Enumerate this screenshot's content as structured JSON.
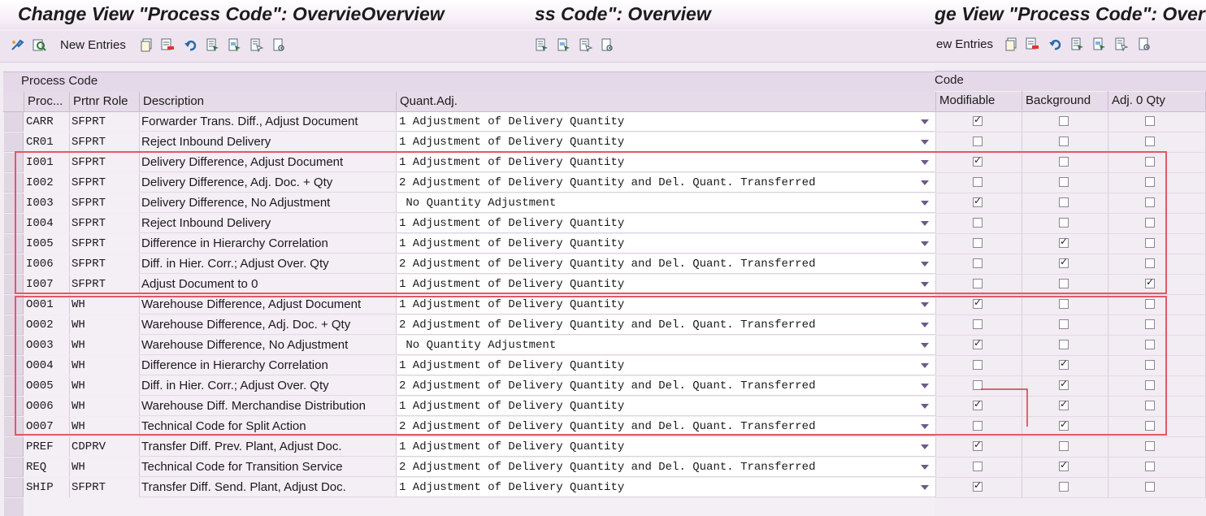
{
  "title_bar": {
    "left_title": "Change View \"Process Code\": OvervieOverview",
    "mid_title": "ss Code\": Overview",
    "right_title": "ge View \"Process Code\": Over"
  },
  "toolbar": {
    "new_entries_left": "New Entries",
    "new_entries_right": "ew Entries"
  },
  "panel": {
    "title_left": "Process Code",
    "title_right": "Code"
  },
  "columns": {
    "proc": "Proc...",
    "role": "Prtnr Role",
    "desc": "Description",
    "quant": "Quant.Adj.",
    "modifiable": "Modifiable",
    "background": "Background",
    "adj0": "Adj. 0 Qty"
  },
  "rows": [
    {
      "code": "CARR",
      "role": "SFPRT",
      "desc": "Forwarder Trans. Diff., Adjust Document",
      "quant": "1 Adjustment of Delivery Quantity",
      "mod": true,
      "bg": false,
      "adj0": false
    },
    {
      "code": "CR01",
      "role": "SFPRT",
      "desc": "Reject Inbound Delivery",
      "quant": "1 Adjustment of Delivery Quantity",
      "mod": false,
      "bg": false,
      "adj0": false
    },
    {
      "code": "I001",
      "role": "SFPRT",
      "desc": "Delivery Difference, Adjust Document",
      "quant": "1 Adjustment of Delivery Quantity",
      "mod": true,
      "bg": false,
      "adj0": false
    },
    {
      "code": "I002",
      "role": "SFPRT",
      "desc": "Delivery Difference, Adj. Doc. + Qty",
      "quant": "2 Adjustment of Delivery Quantity and Del. Quant. Transferred",
      "mod": false,
      "bg": false,
      "adj0": false
    },
    {
      "code": "I003",
      "role": "SFPRT",
      "desc": "Delivery Difference, No Adjustment",
      "quant": " No Quantity Adjustment",
      "mod": true,
      "bg": false,
      "adj0": false
    },
    {
      "code": "I004",
      "role": "SFPRT",
      "desc": "Reject Inbound Delivery",
      "quant": "1 Adjustment of Delivery Quantity",
      "mod": false,
      "bg": false,
      "adj0": false
    },
    {
      "code": "I005",
      "role": "SFPRT",
      "desc": "Difference in Hierarchy Correlation",
      "quant": "1 Adjustment of Delivery Quantity",
      "mod": false,
      "bg": true,
      "adj0": false
    },
    {
      "code": "I006",
      "role": "SFPRT",
      "desc": "Diff. in Hier. Corr.; Adjust Over. Qty",
      "quant": "2 Adjustment of Delivery Quantity and Del. Quant. Transferred",
      "mod": false,
      "bg": true,
      "adj0": false
    },
    {
      "code": "I007",
      "role": "SFPRT",
      "desc": "Adjust Document to 0",
      "quant": "1 Adjustment of Delivery Quantity",
      "mod": false,
      "bg": false,
      "adj0": true
    },
    {
      "code": "O001",
      "role": "WH",
      "desc": "Warehouse Difference, Adjust Document",
      "quant": "1 Adjustment of Delivery Quantity",
      "mod": true,
      "bg": false,
      "adj0": false
    },
    {
      "code": "O002",
      "role": "WH",
      "desc": "Warehouse Difference, Adj. Doc. + Qty",
      "quant": "2 Adjustment of Delivery Quantity and Del. Quant. Transferred",
      "mod": false,
      "bg": false,
      "adj0": false
    },
    {
      "code": "O003",
      "role": "WH",
      "desc": "Warehouse Difference, No Adjustment",
      "quant": " No Quantity Adjustment",
      "mod": true,
      "bg": false,
      "adj0": false
    },
    {
      "code": "O004",
      "role": "WH",
      "desc": "Difference in Hierarchy Correlation",
      "quant": "1 Adjustment of Delivery Quantity",
      "mod": false,
      "bg": true,
      "adj0": false
    },
    {
      "code": "O005",
      "role": "WH",
      "desc": "Diff. in Hier. Corr.; Adjust Over. Qty",
      "quant": "2 Adjustment of Delivery Quantity and Del. Quant. Transferred",
      "mod": false,
      "bg": true,
      "adj0": false
    },
    {
      "code": "O006",
      "role": "WH",
      "desc": "Warehouse Diff. Merchandise Distribution",
      "quant": "1 Adjustment of Delivery Quantity",
      "mod": true,
      "bg": true,
      "adj0": false
    },
    {
      "code": "O007",
      "role": "WH",
      "desc": "Technical Code for Split Action",
      "quant": "2 Adjustment of Delivery Quantity and Del. Quant. Transferred",
      "mod": false,
      "bg": true,
      "adj0": false
    },
    {
      "code": "PREF",
      "role": "CDPRV",
      "desc": "Transfer Diff. Prev. Plant, Adjust Doc.",
      "quant": "1 Adjustment of Delivery Quantity",
      "mod": true,
      "bg": false,
      "adj0": false
    },
    {
      "code": "REQ",
      "role": "WH",
      "desc": "Technical Code for Transition Service",
      "quant": "2 Adjustment of Delivery Quantity and Del. Quant. Transferred",
      "mod": false,
      "bg": true,
      "adj0": false
    },
    {
      "code": "SHIP",
      "role": "SFPRT",
      "desc": "Transfer Diff. Send. Plant, Adjust Doc.",
      "quant": "1 Adjustment of Delivery Quantity",
      "mod": true,
      "bg": false,
      "adj0": false
    }
  ],
  "colors": {
    "highlight_box": "#e05a66",
    "dropdown_arrow": "#6c5a86"
  },
  "icons": [
    "customize-icon",
    "find-icon",
    "display-icon",
    "delete-icon",
    "undo-icon",
    "select-all-icon",
    "select-block-icon",
    "deselect-all-icon",
    "config-icon"
  ]
}
